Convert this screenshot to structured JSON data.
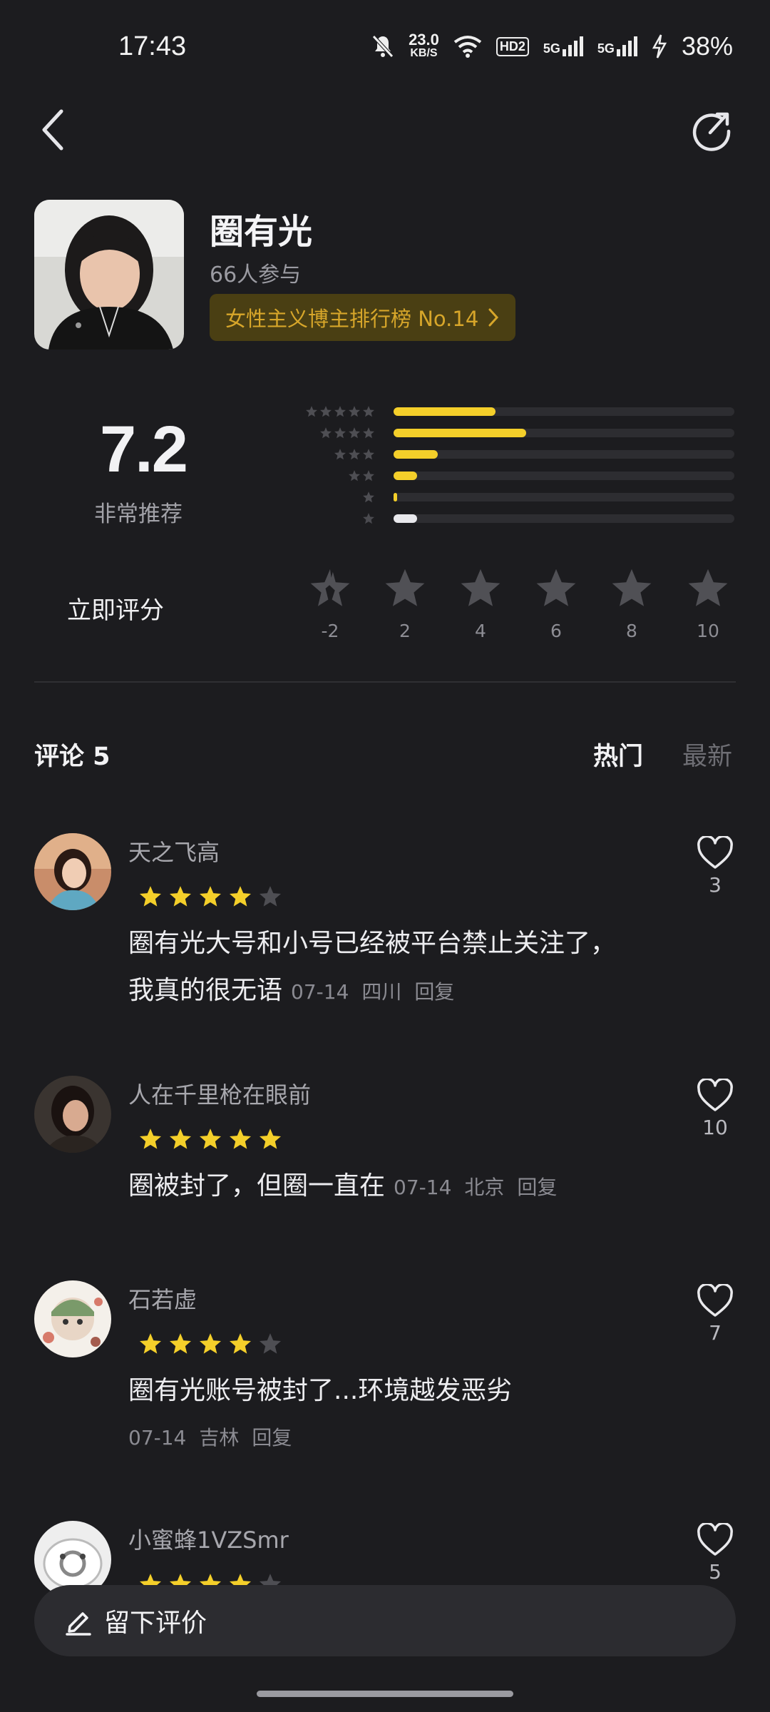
{
  "status": {
    "time": "17:43",
    "net_speed": "23.0",
    "net_unit": "KB/S",
    "hd": "HD2",
    "sig1": "5G",
    "sig2": "5G",
    "battery": "38%"
  },
  "profile": {
    "name": "圈有光",
    "participants": "66人参与",
    "rank_label": "女性主义博主排行榜 No.14"
  },
  "rating": {
    "score": "7.2",
    "score_label": "非常推荐",
    "distribution": [
      {
        "stars": 5,
        "fraction": 0.3,
        "color": "#f4cf2a"
      },
      {
        "stars": 4,
        "fraction": 0.39,
        "color": "#f4cf2a"
      },
      {
        "stars": 3,
        "fraction": 0.13,
        "color": "#f4cf2a"
      },
      {
        "stars": 2,
        "fraction": 0.07,
        "color": "#f4cf2a"
      },
      {
        "stars": 1,
        "fraction": 0.01,
        "color": "#f4cf2a"
      },
      {
        "stars": 0,
        "fraction": 0.07,
        "color": "#e8e8ec"
      }
    ],
    "rate_now_label": "立即评分",
    "options": [
      "-2",
      "2",
      "4",
      "6",
      "8",
      "10"
    ]
  },
  "comments": {
    "title": "评论 5",
    "tab_hot": "热门",
    "tab_new": "最新",
    "items": [
      {
        "user": "天之飞高",
        "stars": 4,
        "text_line1": "圈有光大号和小号已经被平台禁止关注了，",
        "text_line2": "我真的很无语",
        "date": "07-14",
        "location": "四川",
        "reply": "回复",
        "likes": "3"
      },
      {
        "user": "人在千里枪在眼前",
        "stars": 5,
        "text_line1": "圈被封了，但圈一直在",
        "date": "07-14",
        "location": "北京",
        "reply": "回复",
        "likes": "10"
      },
      {
        "user": "石若虚",
        "stars": 4,
        "text_line1": "圈有光账号被封了...环境越发恶劣",
        "date": "07-14",
        "location": "吉林",
        "reply": "回复",
        "likes": "7"
      },
      {
        "user": "小蜜蜂1VZSmr",
        "stars": 4,
        "likes": "5"
      }
    ]
  },
  "bottom": {
    "leave_review": "留下评价"
  },
  "colors": {
    "accent": "#f4cf2a",
    "background": "#1c1c1f",
    "rank_bg": "#4a3f13",
    "rank_text": "#d7a62a"
  },
  "icons": {
    "back": "chevron-left-icon",
    "share": "share-icon",
    "like": "heart-outline-icon",
    "edit": "pencil-icon"
  }
}
